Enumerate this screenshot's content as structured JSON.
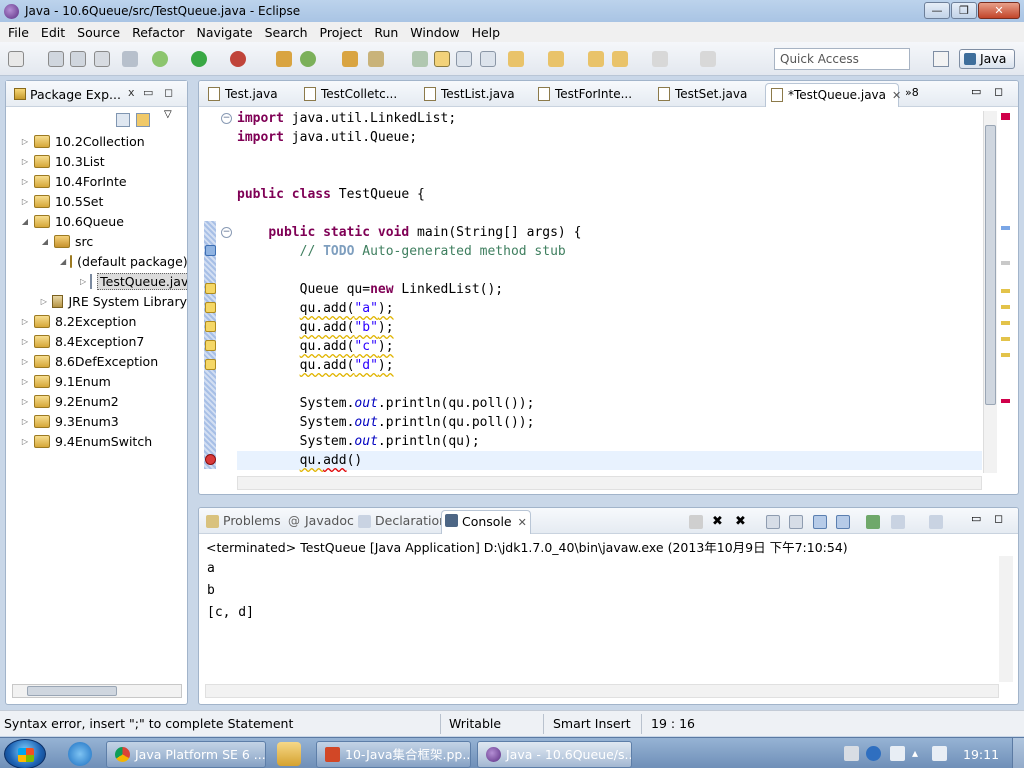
{
  "window": {
    "title": "Java - 10.6Queue/src/TestQueue.java - Eclipse",
    "minimize": "—",
    "maximize": "❐",
    "close": "✕"
  },
  "menubar": [
    "File",
    "Edit",
    "Source",
    "Refactor",
    "Navigate",
    "Search",
    "Project",
    "Run",
    "Window",
    "Help"
  ],
  "toolbar": {
    "quick_access_placeholder": "Quick Access",
    "perspective": "Java"
  },
  "package_explorer": {
    "title": "Package Exp...",
    "tree": [
      {
        "label": "10.2Collection",
        "depth": 0,
        "arrow": "▷",
        "icon": "project"
      },
      {
        "label": "10.3List",
        "depth": 0,
        "arrow": "▷",
        "icon": "project"
      },
      {
        "label": "10.4ForInte",
        "depth": 0,
        "arrow": "▷",
        "icon": "project"
      },
      {
        "label": "10.5Set",
        "depth": 0,
        "arrow": "▷",
        "icon": "project"
      },
      {
        "label": "10.6Queue",
        "depth": 0,
        "arrow": "◢",
        "icon": "project"
      },
      {
        "label": "src",
        "depth": 1,
        "arrow": "◢",
        "icon": "src-folder"
      },
      {
        "label": "(default package)",
        "depth": 2,
        "arrow": "◢",
        "icon": "package"
      },
      {
        "label": "TestQueue.java",
        "depth": 3,
        "arrow": "▷",
        "icon": "java-file",
        "selected": true
      },
      {
        "label": "JRE System Library",
        "depth": 1,
        "arrow": "▷",
        "icon": "library"
      },
      {
        "label": "8.2Exception",
        "depth": 0,
        "arrow": "▷",
        "icon": "project"
      },
      {
        "label": "8.4Exception7",
        "depth": 0,
        "arrow": "▷",
        "icon": "project"
      },
      {
        "label": "8.6DefException",
        "depth": 0,
        "arrow": "▷",
        "icon": "project"
      },
      {
        "label": "9.1Enum",
        "depth": 0,
        "arrow": "▷",
        "icon": "project"
      },
      {
        "label": "9.2Enum2",
        "depth": 0,
        "arrow": "▷",
        "icon": "project"
      },
      {
        "label": "9.3Enum3",
        "depth": 0,
        "arrow": "▷",
        "icon": "project"
      },
      {
        "label": "9.4EnumSwitch",
        "depth": 0,
        "arrow": "▷",
        "icon": "project"
      }
    ]
  },
  "editor": {
    "tabs": [
      {
        "label": "Test.java"
      },
      {
        "label": "TestColletc..."
      },
      {
        "label": "TestList.java"
      },
      {
        "label": "TestForInte..."
      },
      {
        "label": "TestSet.java"
      },
      {
        "label": "*TestQueue.java",
        "active": true
      }
    ],
    "overflow_count": "»8",
    "code": {
      "l1a": "import",
      "l1b": " java.util.LinkedList;",
      "l2a": "import",
      "l2b": " java.util.Queue;",
      "l3a": "public",
      "l3b": "class",
      "l3c": " TestQueue {",
      "l4a": "public",
      "l4b": "static",
      "l4c": "void",
      "l4d": " main(String[] args) {",
      "l5a": "// ",
      "l5b": "TODO",
      "l5c": " Auto-generated method stub",
      "l6a": "Queue qu=",
      "l6b": "new",
      "l6c": " LinkedList();",
      "l7a": "qu.add(",
      "l7b": "\"a\"",
      "l7c": ");",
      "l8a": "qu.add(",
      "l8b": "\"b\"",
      "l8c": ");",
      "l9a": "qu.add(",
      "l9b": "\"c\"",
      "l9c": ");",
      "l10a": "qu.add(",
      "l10b": "\"d\"",
      "l10c": ");",
      "l11a": "System.",
      "l11b": "out",
      "l11c": ".println(qu.poll());",
      "l12a": "System.",
      "l12b": "out",
      "l12c": ".println(qu.poll());",
      "l13a": "System.",
      "l13b": "out",
      "l13c": ".println(qu);",
      "l14a": "qu.",
      "l14b": "add",
      "l14c": "()"
    }
  },
  "console": {
    "tabs": [
      {
        "label": "Problems"
      },
      {
        "label": "Javadoc"
      },
      {
        "label": "Declaration"
      },
      {
        "label": "Console",
        "active": true
      }
    ],
    "status": "<terminated> TestQueue [Java Application] D:\\jdk1.7.0_40\\bin\\javaw.exe (2013年10月9日 下午7:10:54)",
    "output": [
      "a",
      "b",
      "[c, d]"
    ]
  },
  "statusbar": {
    "message": "Syntax error, insert \";\" to complete Statement",
    "mode": "Writable",
    "insert": "Smart Insert",
    "position": "19 : 16"
  },
  "taskbar": {
    "items": [
      {
        "label": "Java Platform SE 6 ..."
      },
      {
        "label": "10-Java集合框架.pp..."
      },
      {
        "label": "Java - 10.6Queue/s...",
        "active": true
      }
    ],
    "clock": "19:11"
  },
  "colors": {
    "keyword": "#7f0055",
    "comment": "#3f7f5f",
    "string": "#2a00ff",
    "field": "#0000c0"
  }
}
